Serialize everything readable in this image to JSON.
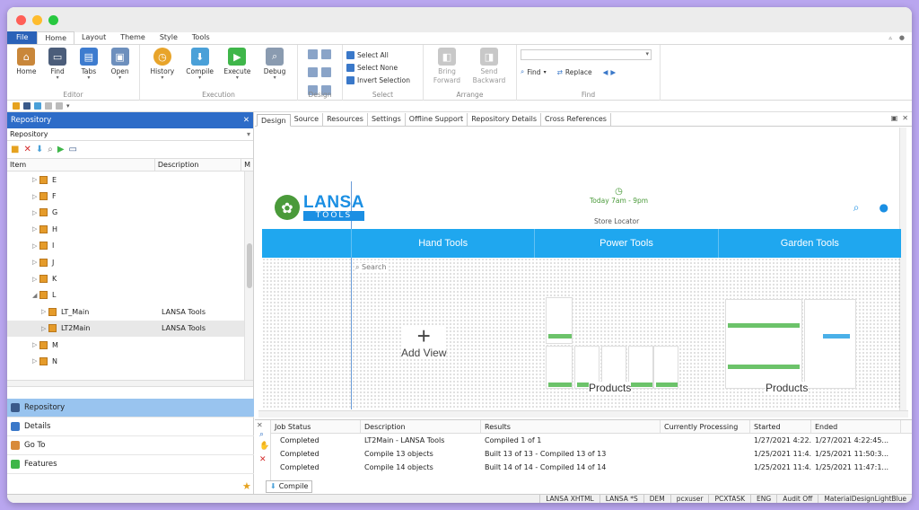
{
  "ribbon": {
    "tabs": [
      "File",
      "Home",
      "Layout",
      "Theme",
      "Style",
      "Tools"
    ],
    "groups": [
      {
        "label": "Editor",
        "buttons": [
          "Home",
          "Find",
          "Tabs",
          "Open"
        ]
      },
      {
        "label": "Execution",
        "buttons": [
          "History",
          "Compile",
          "Execute",
          "Debug"
        ]
      },
      {
        "label": "Design"
      },
      {
        "label": "Select",
        "buttons": [
          "Select All",
          "Select None",
          "Invert Selection"
        ]
      },
      {
        "label": "Arrange",
        "buttons": [
          "Bring\nForward",
          "Send\nBackward"
        ]
      },
      {
        "label": "Find",
        "buttons": [
          "Find",
          "Replace"
        ]
      }
    ]
  },
  "left": {
    "title": "Repository",
    "selector": "Repository",
    "columns": [
      "Item",
      "Description",
      "M"
    ],
    "tree": [
      {
        "label": "E",
        "desc": "",
        "level": 0
      },
      {
        "label": "F",
        "desc": "",
        "level": 0
      },
      {
        "label": "G",
        "desc": "",
        "level": 0
      },
      {
        "label": "H",
        "desc": "",
        "level": 0
      },
      {
        "label": "I",
        "desc": "",
        "level": 0
      },
      {
        "label": "J",
        "desc": "",
        "level": 0
      },
      {
        "label": "K",
        "desc": "",
        "level": 0
      },
      {
        "label": "L",
        "desc": "",
        "level": 0,
        "open": true
      },
      {
        "label": "LT_Main",
        "desc": "LANSA Tools",
        "level": 1
      },
      {
        "label": "LT2Main",
        "desc": "LANSA Tools",
        "level": 1,
        "selected": true
      },
      {
        "label": "M",
        "desc": "",
        "level": 0
      },
      {
        "label": "N",
        "desc": "",
        "level": 0
      }
    ],
    "nav": [
      "Repository",
      "Details",
      "Go To",
      "Features"
    ]
  },
  "doc_tabs": [
    "Design",
    "Source",
    "Resources",
    "Settings",
    "Offline Support",
    "Repository Details",
    "Cross References"
  ],
  "design": {
    "logo_top": "LANSA",
    "logo_bottom": "TOOLS",
    "hours": "Today 7am - 9pm",
    "store": "Store Locator",
    "nav": [
      "",
      "Hand Tools",
      "Power Tools",
      "Garden Tools"
    ],
    "search": "Search",
    "add_view": "Add View",
    "products": [
      "Products",
      "Products"
    ]
  },
  "jobs": {
    "headers": [
      "Job Status",
      "Description",
      "Results",
      "Currently Processing",
      "Started",
      "Ended"
    ],
    "rows": [
      [
        "Completed",
        "LT2Main - LANSA Tools",
        "Compiled 1 of 1",
        "",
        "1/27/2021 4:22...",
        "1/27/2021 4:22:45..."
      ],
      [
        "Completed",
        "Compile 13 objects",
        "Built 13 of 13 - Compiled 13 of 13",
        "",
        "1/25/2021 11:4...",
        "1/25/2021 11:50:3..."
      ],
      [
        "Completed",
        "Compile 14 objects",
        "Built 14 of 14 - Compiled 14 of 14",
        "",
        "1/25/2021 11:4...",
        "1/25/2021 11:47:1..."
      ]
    ],
    "tab": "Compile"
  },
  "status": [
    "LANSA XHTML",
    "LANSA *S",
    "DEM",
    "pcxuser",
    "PCXTASK",
    "ENG",
    "Audit Off",
    "MaterialDesignLightBlue"
  ]
}
